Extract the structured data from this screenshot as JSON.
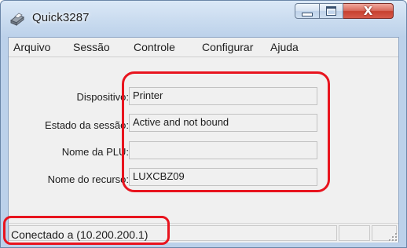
{
  "window": {
    "title": "Quick3287",
    "close_glyph": "X",
    "icon": "printer-icon"
  },
  "menu": {
    "items": [
      "Arquivo",
      "Sessão",
      "Controle",
      "Configurar",
      "Ajuda"
    ]
  },
  "fields": [
    {
      "label": "Dispositivo:",
      "value": "Printer"
    },
    {
      "label": "Estado da sessão:",
      "value": "Active and not bound"
    },
    {
      "label": "Nome da PLU:",
      "value": ""
    },
    {
      "label": "Nome do recurso:",
      "value": "LUXCBZ09"
    }
  ],
  "status": {
    "text": "Conectado a  (10.200.200.1)"
  },
  "colors": {
    "highlight": "#e8141e",
    "titlebar": "#c9dbef",
    "close_button": "#c7402f"
  }
}
